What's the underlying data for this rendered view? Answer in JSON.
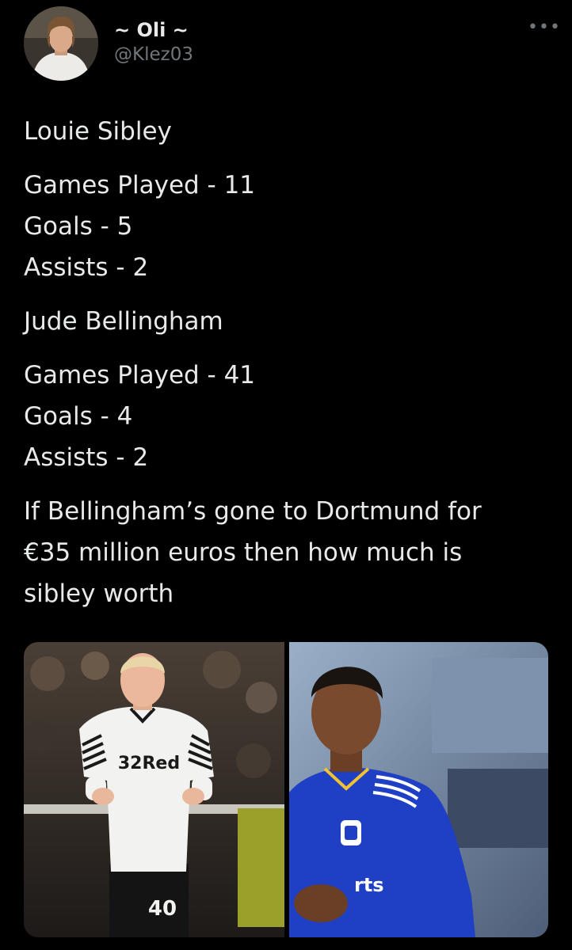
{
  "author": {
    "display_name": "~ Oli ~",
    "handle": "@Klez03",
    "avatar_icon": "profile-photo"
  },
  "more_icon_glyph": "•••",
  "tweet": {
    "player1_name": "Louie Sibley",
    "player1_games": "Games Played - 11",
    "player1_goals": "Goals - 5",
    "player1_assists": "Assists - 2",
    "player2_name": "Jude Bellingham",
    "player2_games": "Games Played - 41",
    "player2_goals": "Goals - 4",
    "player2_assists": "Assists - 2",
    "closing_line1": "If Bellingham’s gone to Dortmund for",
    "closing_line2": "€35 million euros then how much is",
    "closing_line3": "sibley worth"
  },
  "media": {
    "left_photo": {
      "shirt_sponsor": "32Red",
      "shirt_number": "40"
    },
    "right_photo": {
      "shirt_sponsor_fragment": "rts"
    }
  },
  "colors": {
    "background": "#000000",
    "text_primary": "#e7e9ea",
    "text_secondary": "#71767b",
    "derby_shirt": "#f2f2f0",
    "birmingham_shirt": "#1f3fc4"
  }
}
